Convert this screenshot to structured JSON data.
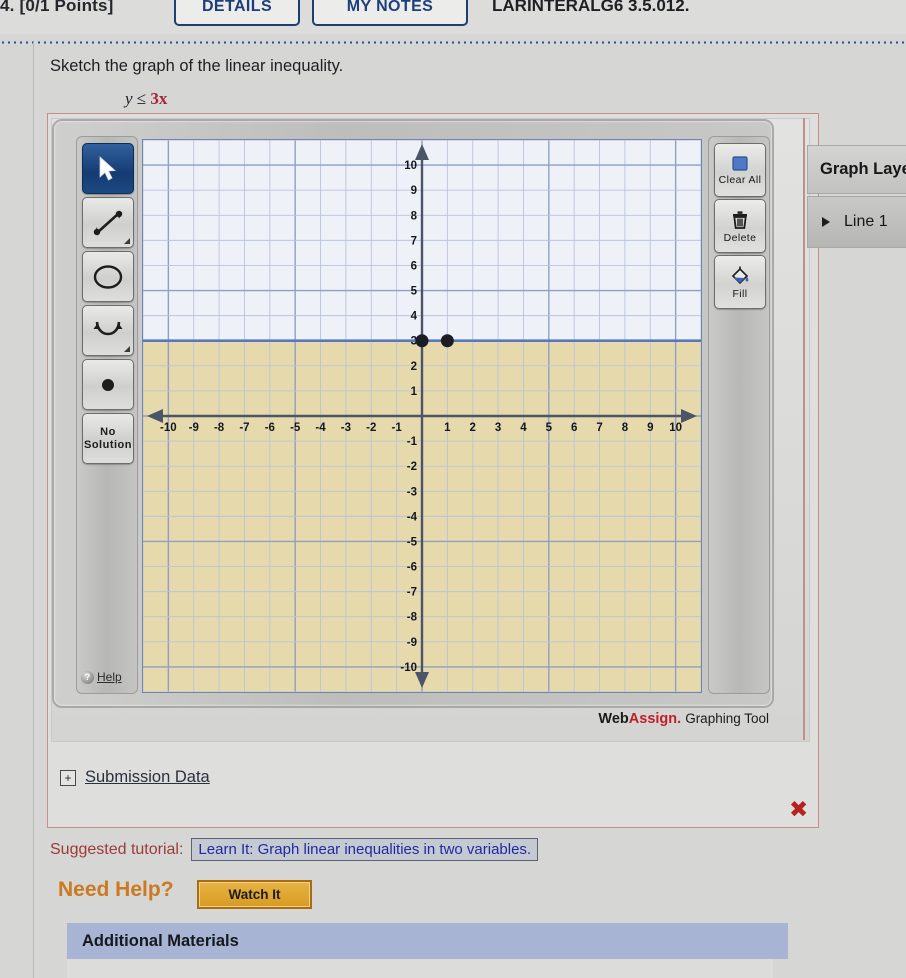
{
  "header": {
    "points": "4. [0/1 Points]",
    "tab_details": "DETAILS",
    "tab_mynotes": "MY NOTES",
    "question_code": "LARINTERALG6 3.5.012."
  },
  "question": {
    "prompt": "Sketch the graph of the linear inequality.",
    "math_lhs": "y",
    "math_rel": "≤",
    "math_rhs": "3x"
  },
  "graph_tool": {
    "credit_web": "Web",
    "credit_assign": "Assign.",
    "credit_label": "Graphing Tool",
    "left_tools": [
      {
        "name": "select",
        "icon": "cursor-arrow-icon",
        "label": "",
        "selected": true
      },
      {
        "name": "line",
        "icon": "double-arrow-line-icon",
        "label": "",
        "selected": false
      },
      {
        "name": "circle",
        "icon": "circle-icon",
        "label": "",
        "selected": false
      },
      {
        "name": "parabola",
        "icon": "parabola-icon",
        "label": "",
        "selected": false
      },
      {
        "name": "point",
        "icon": "filled-dot-icon",
        "label": "",
        "selected": false
      },
      {
        "name": "no-solution",
        "icon": "",
        "label": "No Solution",
        "selected": false
      }
    ],
    "help_label": "Help",
    "right_tools": [
      {
        "name": "clear-all",
        "icon": "blue-square-icon",
        "label": "Clear All"
      },
      {
        "name": "delete",
        "icon": "trash-icon",
        "label": "Delete"
      },
      {
        "name": "fill",
        "icon": "paint-bucket-icon",
        "label": "Fill"
      }
    ],
    "layers_title": "Graph Layers",
    "layers_items": [
      "Line 1"
    ]
  },
  "chart_data": {
    "type": "line",
    "title": "",
    "xlabel": "",
    "ylabel": "",
    "xlim": [
      -11,
      11
    ],
    "ylim": [
      -11,
      11
    ],
    "xticks": [
      -10,
      -9,
      -8,
      -7,
      -6,
      -5,
      -4,
      -3,
      -2,
      -1,
      1,
      2,
      3,
      4,
      5,
      6,
      7,
      8,
      9,
      10
    ],
    "yticks": [
      -10,
      -9,
      -8,
      -7,
      -6,
      -5,
      -4,
      -3,
      -2,
      -1,
      1,
      2,
      3,
      4,
      5,
      6,
      7,
      8,
      9,
      10
    ],
    "grid": true,
    "legend": "none",
    "series": [
      {
        "name": "Line 1",
        "kind": "solid-line",
        "equation": "y = 3",
        "color": "#5579bf",
        "points": [
          {
            "x": 0,
            "y": 3
          },
          {
            "x": 1,
            "y": 3
          }
        ],
        "x_from": -11,
        "x_to": 11
      }
    ],
    "shaded_region": {
      "description": "region below the line y = 3",
      "color": "#e6d9ab",
      "above_color": "#eef1f8"
    },
    "colors": {
      "grid_minor": "#b9c4dc",
      "grid_major": "#8fa0c2",
      "axis": "#4c5568",
      "point": "#1b1d24"
    }
  },
  "submission": {
    "plus_icon": "plus-box-icon",
    "label": "Submission Data",
    "mark_icon": "red-x-icon",
    "mark": "✖"
  },
  "tutorial": {
    "label": "Suggested tutorial:",
    "link": "Learn It: Graph linear inequalities in two variables."
  },
  "help": {
    "need_help": "Need Help?",
    "watch_it": "Watch It"
  },
  "additional": {
    "title": "Additional Materials"
  },
  "colors": {
    "tab_border": "#1f3e73",
    "tab_text": "#1c3f7c",
    "accent_red": "#a32638",
    "watch_it": "#d89a22",
    "additional_bar": "#a8b4d4"
  }
}
